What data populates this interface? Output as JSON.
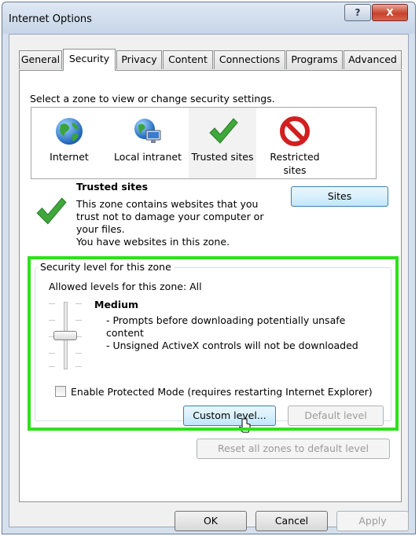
{
  "window": {
    "title": "Internet Options",
    "help_label": "?",
    "close_label": "X"
  },
  "tabs": [
    {
      "label": "General"
    },
    {
      "label": "Security"
    },
    {
      "label": "Privacy"
    },
    {
      "label": "Content"
    },
    {
      "label": "Connections"
    },
    {
      "label": "Programs"
    },
    {
      "label": "Advanced"
    }
  ],
  "active_tab": "Security",
  "security": {
    "zone_prompt": "Select a zone to view or change security settings.",
    "zones": [
      {
        "label": "Internet",
        "icon": "globe-icon"
      },
      {
        "label": "Local intranet",
        "icon": "intranet-icon"
      },
      {
        "label": "Trusted sites",
        "icon": "checkmark-icon"
      },
      {
        "label_line1": "Restricted",
        "label_line2": "sites",
        "icon": "no-entry-icon"
      }
    ],
    "selected_zone": "Trusted sites",
    "zone_info": {
      "title": "Trusted sites",
      "line1": "This zone contains websites that you",
      "line2": "trust not to damage your computer or",
      "line3": "your files.",
      "line4": "You have websites in this zone."
    },
    "sites_button": "Sites",
    "level_group": {
      "legend": "Security level for this zone",
      "allowed": "Allowed levels for this zone: All",
      "level_name": "Medium",
      "desc1": "- Prompts before downloading potentially unsafe",
      "desc1b": "content",
      "desc2": "- Unsigned ActiveX controls will not be downloaded",
      "slider_level": "Medium"
    },
    "protected_mode": {
      "label": "Enable Protected Mode (requires restarting Internet Explorer)",
      "checked": false
    },
    "custom_level_button": "Custom level...",
    "default_level_button": "Default level",
    "reset_all_button": "Reset all zones to default level"
  },
  "footer": {
    "ok": "OK",
    "cancel": "Cancel",
    "apply": "Apply"
  },
  "colors": {
    "highlight_frame": "#2fe01d",
    "check_green": "#3ea83a",
    "restricted_red": "#d21f1f"
  }
}
